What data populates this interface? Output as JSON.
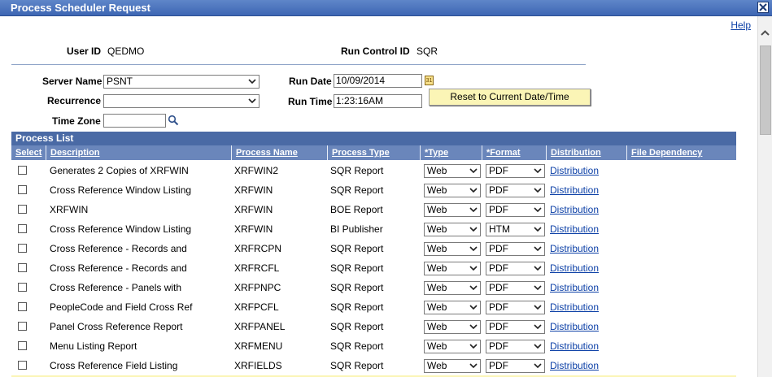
{
  "window": {
    "title": "Process Scheduler Request",
    "help_label": "Help"
  },
  "header": {
    "user_id_label": "User ID",
    "user_id_value": "QEDMO",
    "run_control_label": "Run Control ID",
    "run_control_value": "SQR"
  },
  "form": {
    "server_name_label": "Server Name",
    "server_name_value": "PSNT",
    "recurrence_label": "Recurrence",
    "recurrence_value": "",
    "time_zone_label": "Time Zone",
    "time_zone_value": "",
    "run_date_label": "Run Date",
    "run_date_value": "10/09/2014",
    "calendar_icon_text": "31",
    "run_time_label": "Run Time",
    "run_time_value": "1:23:16AM",
    "reset_button_label": "Reset to Current Date/Time"
  },
  "process_list": {
    "title": "Process List",
    "columns": {
      "select": "Select",
      "description": "Description",
      "process_name": "Process Name",
      "process_type": "Process Type",
      "type": "*Type",
      "format": "*Format",
      "distribution": "Distribution",
      "file_dependency": "File Dependency"
    },
    "rows": [
      {
        "description": "Generates 2 Copies of XRFWIN",
        "process_name": "XRFWIN2",
        "process_type": "SQR Report",
        "type": "Web",
        "format": "PDF",
        "distribution": "Distribution"
      },
      {
        "description": "Cross Reference Window Listing",
        "process_name": "XRFWIN",
        "process_type": "SQR Report",
        "type": "Web",
        "format": "PDF",
        "distribution": "Distribution"
      },
      {
        "description": "XRFWIN",
        "process_name": "XRFWIN",
        "process_type": "BOE Report",
        "type": "Web",
        "format": "PDF",
        "distribution": "Distribution"
      },
      {
        "description": "Cross Reference Window Listing",
        "process_name": "XRFWIN",
        "process_type": "BI Publisher",
        "type": "Web",
        "format": "HTM",
        "distribution": "Distribution"
      },
      {
        "description": "Cross Reference - Records and",
        "process_name": "XRFRCPN",
        "process_type": "SQR Report",
        "type": "Web",
        "format": "PDF",
        "distribution": "Distribution"
      },
      {
        "description": "Cross Reference - Records and",
        "process_name": "XRFRCFL",
        "process_type": "SQR Report",
        "type": "Web",
        "format": "PDF",
        "distribution": "Distribution"
      },
      {
        "description": "Cross Reference - Panels with",
        "process_name": "XRFPNPC",
        "process_type": "SQR Report",
        "type": "Web",
        "format": "PDF",
        "distribution": "Distribution"
      },
      {
        "description": "PeopleCode and Field Cross Ref",
        "process_name": "XRFPCFL",
        "process_type": "SQR Report",
        "type": "Web",
        "format": "PDF",
        "distribution": "Distribution"
      },
      {
        "description": "Panel Cross Reference Report",
        "process_name": "XRFPANEL",
        "process_type": "SQR Report",
        "type": "Web",
        "format": "PDF",
        "distribution": "Distribution"
      },
      {
        "description": "Menu Listing Report",
        "process_name": "XRFMENU",
        "process_type": "SQR Report",
        "type": "Web",
        "format": "PDF",
        "distribution": "Distribution"
      },
      {
        "description": "Cross Reference Field Listing",
        "process_name": "XRFIELDS",
        "process_type": "SQR Report",
        "type": "Web",
        "format": "PDF",
        "distribution": "Distribution"
      }
    ]
  },
  "colors": {
    "title_bar": "#3d66b3",
    "grid_header": "#4a6aa5",
    "column_header": "#6a86bb",
    "link": "#0b3fa6",
    "button": "#fbf5b6"
  },
  "icons": {
    "close": "close-icon",
    "calendar": "calendar-icon",
    "lookup": "search-icon",
    "dropdown": "chevron-down-icon",
    "scroll_up": "chevron-up-icon"
  }
}
